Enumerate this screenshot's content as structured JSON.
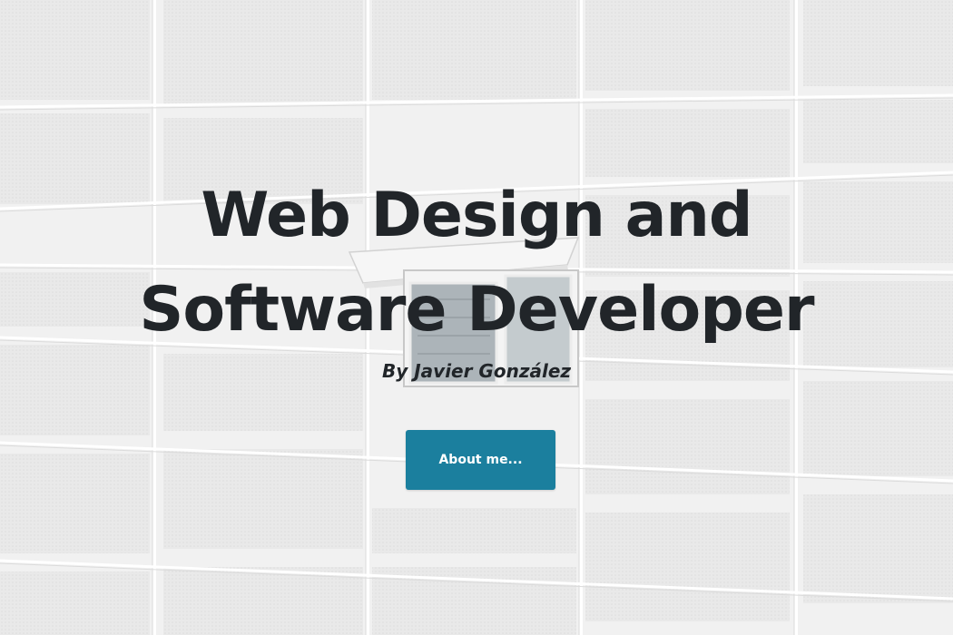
{
  "hero": {
    "title_line1": "Web Design and",
    "title_line2": "Software Developer",
    "subtitle": "By Javier González",
    "button_label": "About me..."
  },
  "colors": {
    "text": "#212529",
    "button": "#1b7f9e",
    "button_text": "#ffffff",
    "background": "#ececec"
  },
  "background_image": "building-facade-with-window"
}
